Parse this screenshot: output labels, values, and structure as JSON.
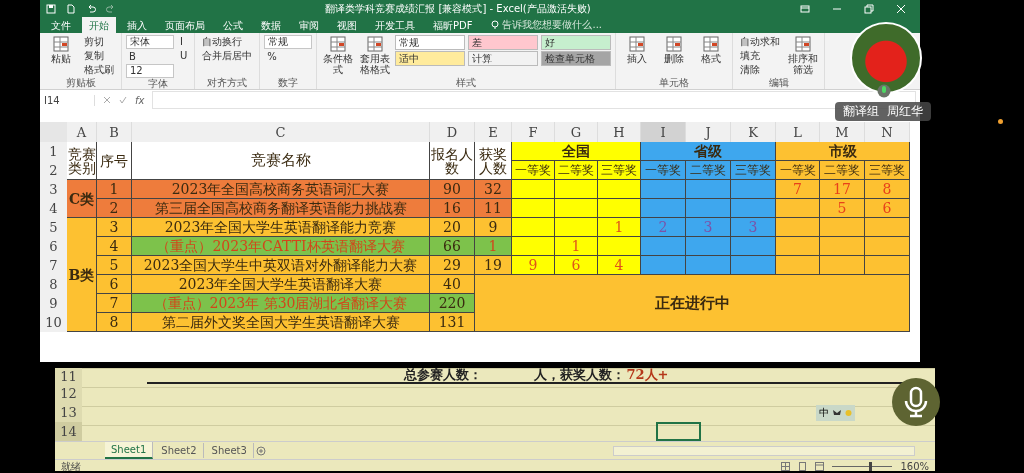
{
  "window": {
    "title": "翻译类学科竞赛成绩汇报 [兼容模式] - Excel(产品激活失败)"
  },
  "menu": [
    {
      "label": "文件",
      "selected": false
    },
    {
      "label": "开始",
      "selected": true
    },
    {
      "label": "插入",
      "selected": false
    },
    {
      "label": "页面布局",
      "selected": false
    },
    {
      "label": "公式",
      "selected": false
    },
    {
      "label": "数据",
      "selected": false
    },
    {
      "label": "审阅",
      "selected": false
    },
    {
      "label": "视图",
      "selected": false
    },
    {
      "label": "开发工具",
      "selected": false
    },
    {
      "label": "福昕PDF",
      "selected": false
    }
  ],
  "tell_me": {
    "placeholder": "告诉我您想要做什么..."
  },
  "ribbon": {
    "groups": [
      {
        "label": "剪贴板",
        "items": [
          {
            "kind": "large",
            "label": "粘贴"
          },
          {
            "kind": "small",
            "label": "剪切"
          },
          {
            "kind": "small",
            "label": "复制"
          },
          {
            "kind": "small",
            "label": "格式刷"
          }
        ]
      },
      {
        "label": "字体",
        "items": [
          {
            "kind": "field",
            "label": "宋体"
          },
          {
            "kind": "small",
            "label": "B"
          },
          {
            "kind": "field",
            "label": "12"
          },
          {
            "kind": "small",
            "label": "I"
          },
          {
            "kind": "small",
            "label": "U"
          }
        ]
      },
      {
        "label": "对齐方式",
        "items": [
          {
            "kind": "small",
            "label": "自动换行"
          },
          {
            "kind": "small",
            "label": "合并后居中"
          }
        ]
      },
      {
        "label": "数字",
        "items": [
          {
            "kind": "field",
            "label": "常规"
          },
          {
            "kind": "small",
            "label": "%"
          }
        ]
      },
      {
        "label": "样式",
        "items": [
          {
            "kind": "large",
            "label": "条件格式"
          },
          {
            "kind": "large",
            "label": "套用表格格式"
          },
          {
            "kind": "style",
            "label": "常规",
            "color": "#ffffff"
          },
          {
            "kind": "style",
            "label": "适中",
            "color": "#ffeb9c"
          },
          {
            "kind": "style",
            "label": "差",
            "color": "#ffc7ce"
          },
          {
            "kind": "style",
            "label": "计算",
            "color": "#f2f2f2"
          },
          {
            "kind": "style",
            "label": "好",
            "color": "#c6efce"
          },
          {
            "kind": "style",
            "label": "检查单元格",
            "color": "#a5a5a5"
          }
        ]
      },
      {
        "label": "单元格",
        "items": [
          {
            "kind": "large",
            "label": "插入"
          },
          {
            "kind": "large",
            "label": "删除"
          },
          {
            "kind": "large",
            "label": "格式"
          }
        ]
      },
      {
        "label": "编辑",
        "items": [
          {
            "kind": "small",
            "label": "自动求和"
          },
          {
            "kind": "small",
            "label": "填充"
          },
          {
            "kind": "small",
            "label": "清除"
          },
          {
            "kind": "large",
            "label": "排序和筛选"
          }
        ]
      }
    ]
  },
  "name_box": {
    "value": "I14"
  },
  "formula_bar": {
    "fx": "fx"
  },
  "columns": [
    {
      "label": "A",
      "selected": false
    },
    {
      "label": "B",
      "selected": false
    },
    {
      "label": "C",
      "selected": false
    },
    {
      "label": "D",
      "selected": false
    },
    {
      "label": "E",
      "selected": false
    },
    {
      "label": "F",
      "selected": false
    },
    {
      "label": "G",
      "selected": false
    },
    {
      "label": "H",
      "selected": false
    },
    {
      "label": "I",
      "selected": true
    },
    {
      "label": "J",
      "selected": false
    },
    {
      "label": "K",
      "selected": false
    },
    {
      "label": "L",
      "selected": false
    },
    {
      "label": "M",
      "selected": false
    },
    {
      "label": "N",
      "selected": false
    }
  ],
  "row_numbers": [
    "1",
    "2",
    "3",
    "4",
    "5",
    "6",
    "7",
    "8",
    "9",
    "10"
  ],
  "table": {
    "header": {
      "category": "竞赛类别",
      "number": "序号",
      "name": "竞赛名称",
      "signups": "报名人数",
      "awards": "获奖人数"
    },
    "groups": [
      {
        "name": "全国",
        "color": "#ffff00",
        "prizes": [
          "一等奖",
          "二等奖",
          "三等奖"
        ]
      },
      {
        "name": "省级",
        "color": "#3ea7ee",
        "prizes": [
          "一等奖",
          "二等奖",
          "三等奖"
        ]
      },
      {
        "name": "市级",
        "color": "#fdc131",
        "prizes": [
          "一等奖",
          "二等奖",
          "三等奖"
        ]
      }
    ],
    "categories": [
      {
        "name": "C类",
        "color": "#ee7c3c",
        "competitions": [
          {
            "number": "1",
            "name": "2023年全国高校商务英语词汇大赛",
            "signups": "90",
            "awards": "32",
            "key": false,
            "prizes": {
              "city": {
                "first": "7",
                "second": "17",
                "third": "8"
              }
            }
          },
          {
            "number": "2",
            "name": "第三届全国高校商务翻译英语能力挑战赛",
            "signups": "16",
            "awards": "11",
            "key": false,
            "prizes": {
              "city": {
                "second": "5",
                "third": "6"
              }
            }
          }
        ]
      },
      {
        "name": "B类",
        "color": "#fdc131",
        "competitions": [
          {
            "number": "3",
            "name": "2023年全国大学生英语翻译能力竞赛",
            "signups": "20",
            "awards": "9",
            "key": false,
            "prizes": {
              "national": {
                "third": "1"
              },
              "provincial": {
                "first": "2",
                "second": "3",
                "third": "3"
              }
            }
          },
          {
            "number": "4",
            "name": "（重点）2023年CATTI杯英语翻译大赛",
            "signups": "66",
            "awards": "1",
            "key": true,
            "prizes": {
              "national": {
                "second": "1"
              }
            }
          },
          {
            "number": "5",
            "name": "2023全国大学生中英双语对外翻译能力大赛",
            "signups": "29",
            "awards": "19",
            "key": false,
            "prizes": {
              "national": {
                "first": "9",
                "second": "6",
                "third": "4"
              }
            }
          },
          {
            "number": "6",
            "name": "2023年全国大学生英语翻译大赛",
            "signups": "40",
            "key": false
          },
          {
            "number": "7",
            "name": "（重点）2023年 第30届湖北省翻译大赛",
            "signups": "220",
            "key": true
          },
          {
            "number": "8",
            "name": "第二届外文奖全国大学生英语翻译大赛",
            "signups": "131",
            "key": false
          }
        ]
      }
    ],
    "ongoing_note": "正在进行中"
  },
  "lower_rows": [
    {
      "number": "11",
      "selected": false
    },
    {
      "number": "12",
      "selected": false
    },
    {
      "number": "13",
      "selected": false
    },
    {
      "number": "14",
      "selected": true
    }
  ],
  "summary": {
    "signups_label": "总参赛人数：",
    "awards_label": "人，获奖人数：",
    "awards_value": "72人+"
  },
  "sheets": [
    {
      "label": "Sheet1",
      "selected": true
    },
    {
      "label": "Sheet2",
      "selected": false
    },
    {
      "label": "Sheet3",
      "selected": false
    }
  ],
  "status_bar": {
    "status": "就绪",
    "zoom": {
      "reading": "160%",
      "level": 0.62
    }
  },
  "ime_toolbar": {
    "mode": "中"
  },
  "participant": {
    "group": "翻译组",
    "name": "周红华"
  }
}
